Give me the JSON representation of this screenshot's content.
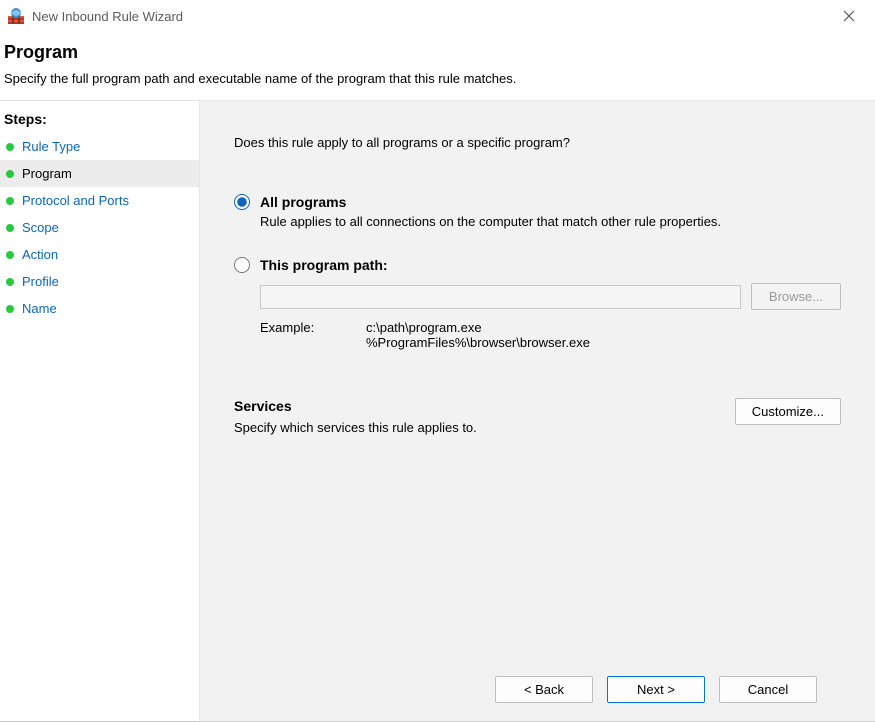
{
  "window": {
    "title": "New Inbound Rule Wizard"
  },
  "header": {
    "title": "Program",
    "subtitle": "Specify the full program path and executable name of the program that this rule matches."
  },
  "sidebar": {
    "heading": "Steps:",
    "items": [
      {
        "label": "Rule Type",
        "active": false
      },
      {
        "label": "Program",
        "active": true
      },
      {
        "label": "Protocol and Ports",
        "active": false
      },
      {
        "label": "Scope",
        "active": false
      },
      {
        "label": "Action",
        "active": false
      },
      {
        "label": "Profile",
        "active": false
      },
      {
        "label": "Name",
        "active": false
      }
    ]
  },
  "main": {
    "prompt": "Does this rule apply to all programs or a specific program?",
    "options": {
      "all": {
        "label": "All programs",
        "desc": "Rule applies to all connections on the computer that match other rule properties."
      },
      "path": {
        "label": "This program path:",
        "value": "",
        "example_label": "Example:",
        "example_values": "c:\\path\\program.exe\n%ProgramFiles%\\browser\\browser.exe"
      }
    },
    "browse_label": "Browse...",
    "services": {
      "title": "Services",
      "desc": "Specify which services this rule applies to.",
      "customize_label": "Customize..."
    }
  },
  "footer": {
    "back": "< Back",
    "next": "Next >",
    "cancel": "Cancel"
  }
}
